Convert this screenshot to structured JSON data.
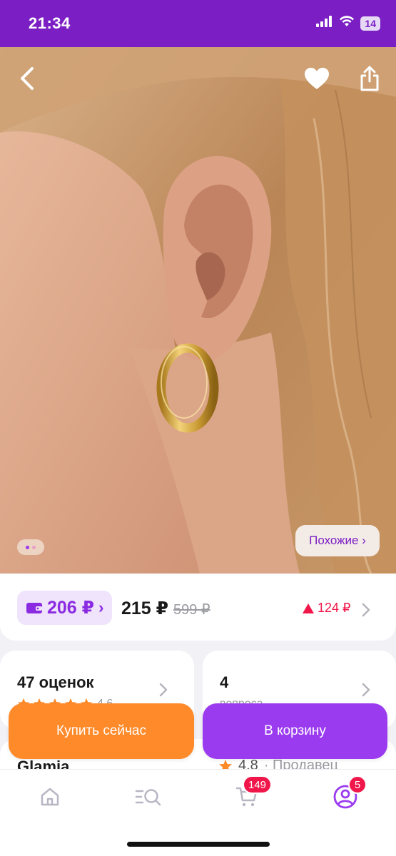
{
  "status_bar": {
    "time": "21:34",
    "battery": "14",
    "icons": [
      "signal-icon",
      "wifi-icon",
      "battery-icon"
    ]
  },
  "header": {
    "icons": [
      "back-icon",
      "heart-icon",
      "share-icon"
    ]
  },
  "gallery": {
    "image": "product-photo-hoop-earring",
    "similar_label": "Похожие ›",
    "page_count": 2,
    "current_page": 1
  },
  "price": {
    "wallet_price": "206 ₽",
    "wallet_chevron": "›",
    "regular_price": "215 ₽",
    "old_price": "599 ₽",
    "cashback": "124 ₽"
  },
  "reviews": {
    "count_label": "47 оценок",
    "rating": "4.6",
    "stars": 5
  },
  "questions": {
    "count": "4",
    "label": "вопроса"
  },
  "seller": {
    "name": "Glamia",
    "rating": "4.8",
    "role": "· Продавец"
  },
  "actions": {
    "buy_now": "Купить сейчас",
    "add_to_cart": "В корзину"
  },
  "bottom_nav": {
    "items": [
      "home-icon",
      "catalog-search-icon",
      "cart-icon",
      "profile-icon"
    ],
    "cart_badge": "149",
    "profile_badge": "5"
  },
  "colors": {
    "brand": "#7b1fc4",
    "cart_button": "#9b3bf0",
    "buy_button": "#ff8a2a",
    "accent_red": "#f0164a"
  }
}
